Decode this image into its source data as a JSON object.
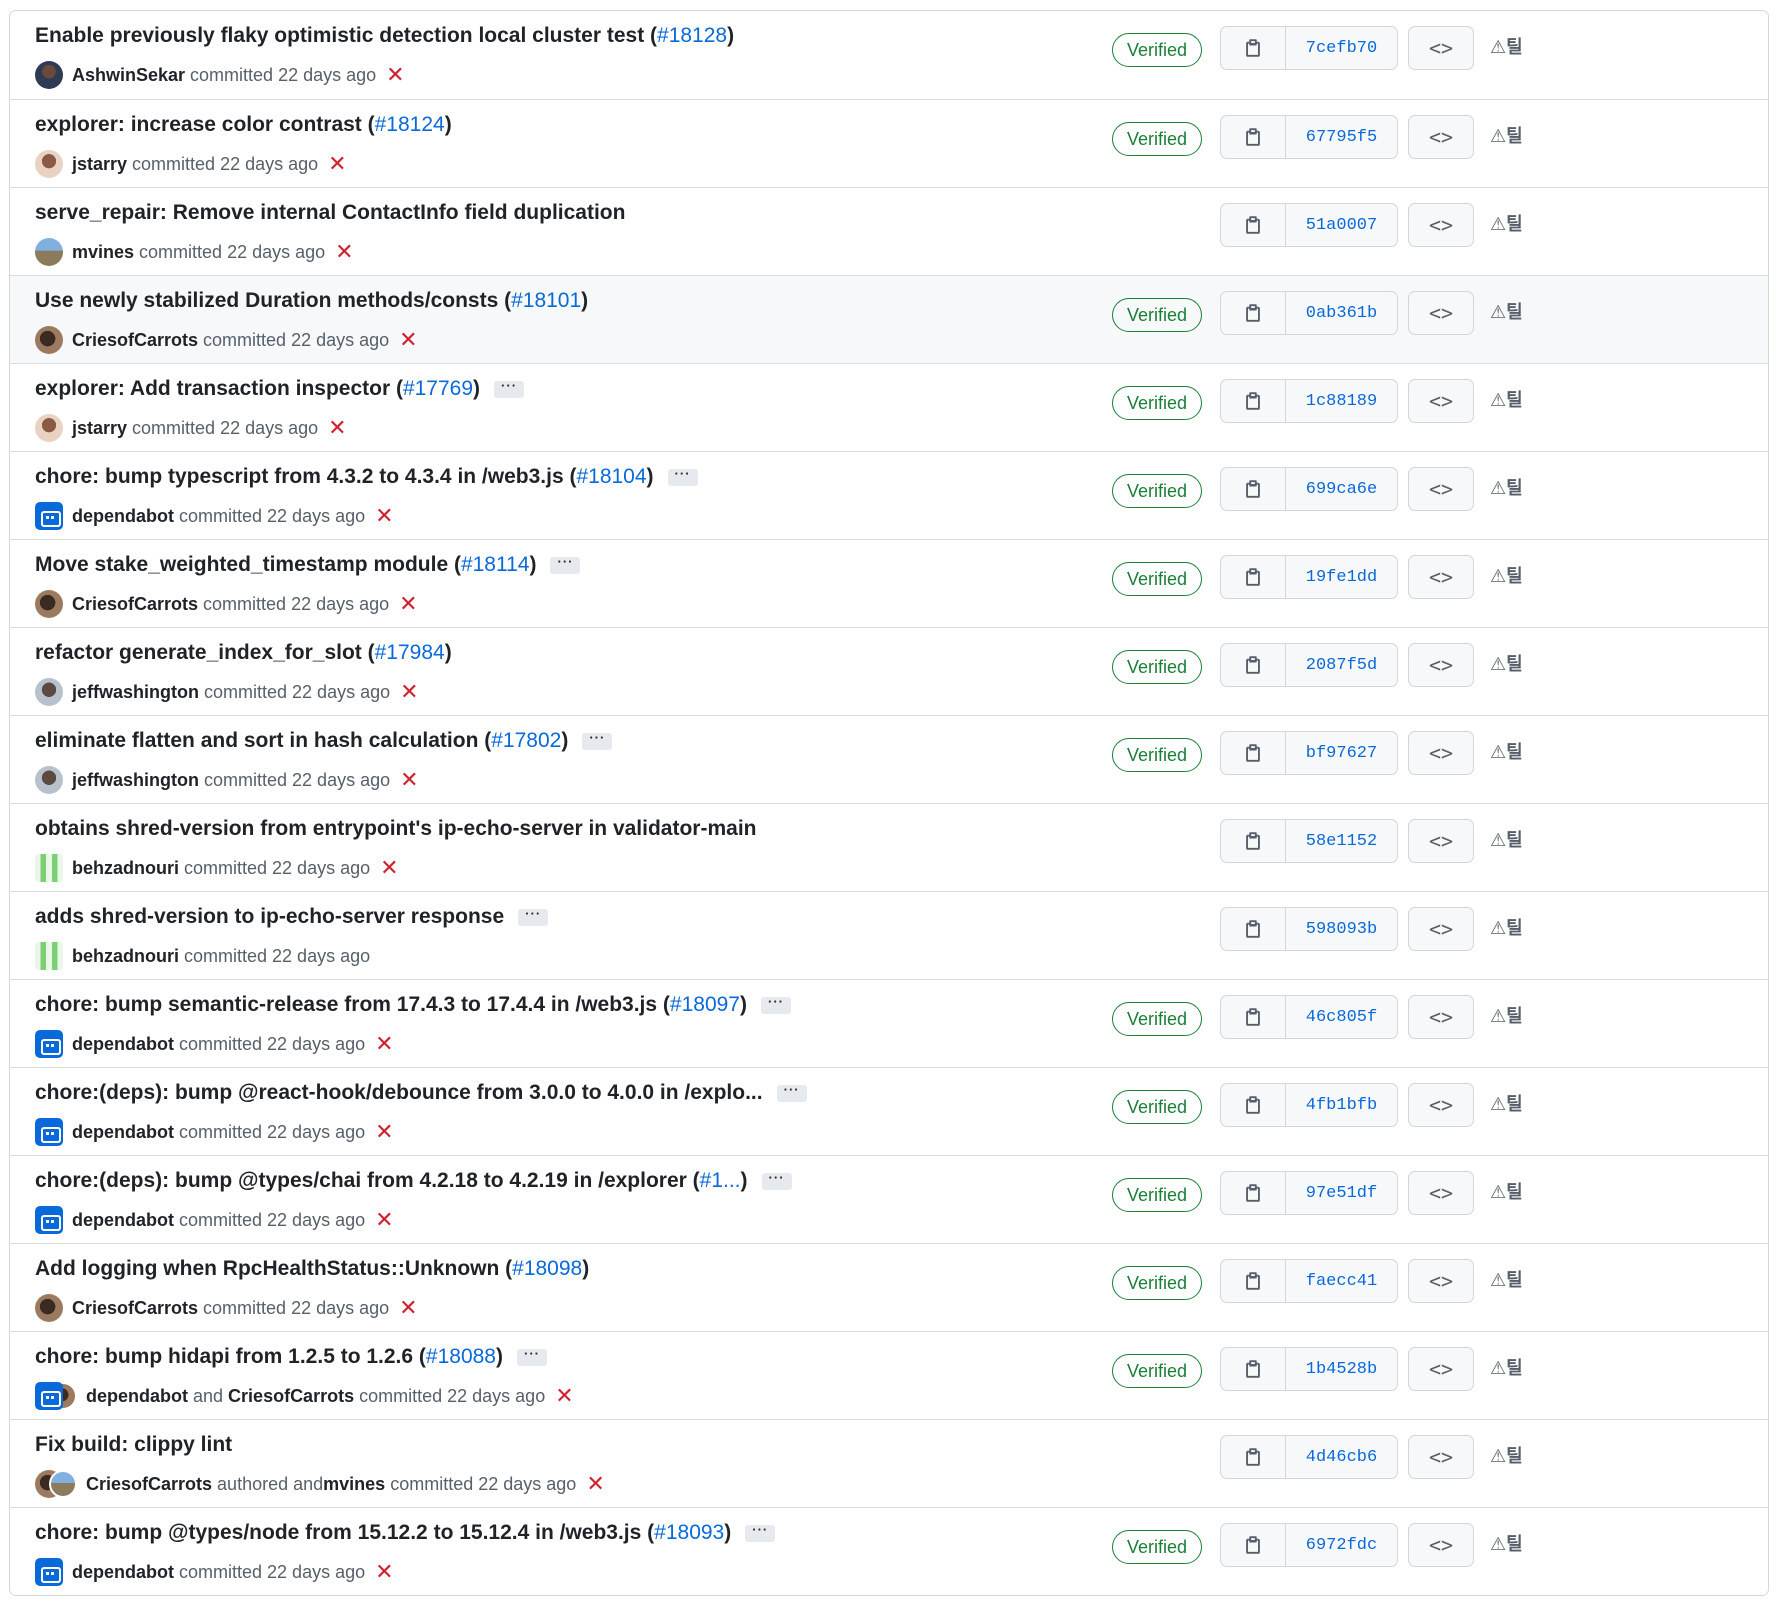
{
  "labels": {
    "committed": "committed",
    "authored": "authored",
    "and": "and",
    "time": "22 days ago",
    "verified": "Verified",
    "more": "···",
    "fail_mark": "✕",
    "browse": "<>",
    "extra": "⚠틸"
  },
  "icons": {
    "copy": "clipboard-icon",
    "browse": "code-icon",
    "status": "x-icon",
    "extra": "alert-icon"
  },
  "colors": {
    "verified": "#1a7f37",
    "link": "#0969da",
    "fail": "#cf222e"
  },
  "commits": [
    {
      "title": "Enable previously flaky optimistic detection local cluster test",
      "pr": "#18128",
      "ellipsis": false,
      "avatars": [
        "a-ashwin"
      ],
      "author": "AshwinSekar",
      "verified": true,
      "failed": true,
      "sha": "7cefb70"
    },
    {
      "title": "explorer: increase color contrast",
      "pr": "#18124",
      "ellipsis": false,
      "avatars": [
        "a-jstarry"
      ],
      "author": "jstarry",
      "verified": true,
      "failed": true,
      "sha": "67795f5"
    },
    {
      "title": "serve_repair: Remove internal ContactInfo field duplication",
      "pr": "",
      "ellipsis": false,
      "avatars": [
        "a-mvines"
      ],
      "author": "mvines",
      "verified": false,
      "failed": true,
      "sha": "51a0007"
    },
    {
      "title": "Use newly stabilized Duration methods/consts",
      "pr": "#18101",
      "ellipsis": false,
      "avatars": [
        "a-cries"
      ],
      "author": "CriesofCarrots",
      "verified": true,
      "failed": true,
      "sha": "0ab361b",
      "hovered": true
    },
    {
      "title": "explorer: Add transaction inspector",
      "pr": "#17769",
      "ellipsis": true,
      "avatars": [
        "a-jstarry"
      ],
      "author": "jstarry",
      "verified": true,
      "failed": true,
      "sha": "1c88189"
    },
    {
      "title": "chore: bump typescript from 4.3.2 to 4.3.4 in /web3.js",
      "pr": "#18104",
      "ellipsis": true,
      "avatars": [
        "bot"
      ],
      "author": "dependabot",
      "verified": true,
      "failed": true,
      "sha": "699ca6e"
    },
    {
      "title": "Move stake_weighted_timestamp module",
      "pr": "#18114",
      "ellipsis": true,
      "avatars": [
        "a-cries"
      ],
      "author": "CriesofCarrots",
      "verified": true,
      "failed": true,
      "sha": "19fe1dd"
    },
    {
      "title": "refactor generate_index_for_slot",
      "pr": "#17984",
      "ellipsis": false,
      "avatars": [
        "a-jeff"
      ],
      "author": "jeffwashington",
      "verified": true,
      "failed": true,
      "sha": "2087f5d"
    },
    {
      "title": "eliminate flatten and sort in hash calculation",
      "pr": "#17802",
      "ellipsis": true,
      "avatars": [
        "a-jeff"
      ],
      "author": "jeffwashington",
      "verified": true,
      "failed": true,
      "sha": "bf97627"
    },
    {
      "title": "obtains shred-version from entrypoint's ip-echo-server in validator-main",
      "pr": "",
      "ellipsis": false,
      "avatars": [
        "a-behzad"
      ],
      "author": "behzadnouri",
      "verified": false,
      "failed": true,
      "sha": "58e1152"
    },
    {
      "title": "adds shred-version to ip-echo-server response",
      "pr": "",
      "ellipsis": true,
      "avatars": [
        "a-behzad"
      ],
      "author": "behzadnouri",
      "verified": false,
      "failed": false,
      "sha": "598093b"
    },
    {
      "title": "chore: bump semantic-release from 17.4.3 to 17.4.4 in /web3.js",
      "pr": "#18097",
      "ellipsis": true,
      "avatars": [
        "bot"
      ],
      "author": "dependabot",
      "verified": true,
      "failed": true,
      "sha": "46c805f"
    },
    {
      "title": "chore:(deps): bump @react-hook/debounce from 3.0.0 to 4.0.0 in /explo...",
      "pr": "",
      "ellipsis": true,
      "avatars": [
        "bot"
      ],
      "author": "dependabot",
      "verified": true,
      "failed": true,
      "sha": "4fb1bfb"
    },
    {
      "title": "chore:(deps): bump @types/chai from 4.2.18 to 4.2.19 in /explorer",
      "pr": "#1...",
      "ellipsis": true,
      "avatars": [
        "bot"
      ],
      "author": "dependabot",
      "verified": true,
      "failed": true,
      "sha": "97e51df"
    },
    {
      "title": "Add logging when RpcHealthStatus::Unknown",
      "pr": "#18098",
      "ellipsis": false,
      "avatars": [
        "a-cries"
      ],
      "author": "CriesofCarrots",
      "verified": true,
      "failed": true,
      "sha": "faecc41"
    },
    {
      "title": "chore: bump hidapi from 1.2.5 to 1.2.6",
      "pr": "#18088",
      "ellipsis": true,
      "avatars": [
        "bot",
        "a-cries"
      ],
      "author": "dependabot",
      "coauthor": "CriesofCarrots",
      "verified": true,
      "failed": true,
      "sha": "1b4528b"
    },
    {
      "title": "Fix build: clippy lint",
      "pr": "",
      "ellipsis": false,
      "avatars": [
        "a-cries",
        "a-mvines"
      ],
      "author": "CriesofCarrots",
      "committer": "mvines",
      "verified": false,
      "failed": true,
      "sha": "4d46cb6"
    },
    {
      "title": "chore: bump @types/node from 15.12.2 to 15.12.4 in /web3.js",
      "pr": "#18093",
      "ellipsis": true,
      "avatars": [
        "bot"
      ],
      "author": "dependabot",
      "verified": true,
      "failed": true,
      "sha": "6972fdc"
    }
  ]
}
